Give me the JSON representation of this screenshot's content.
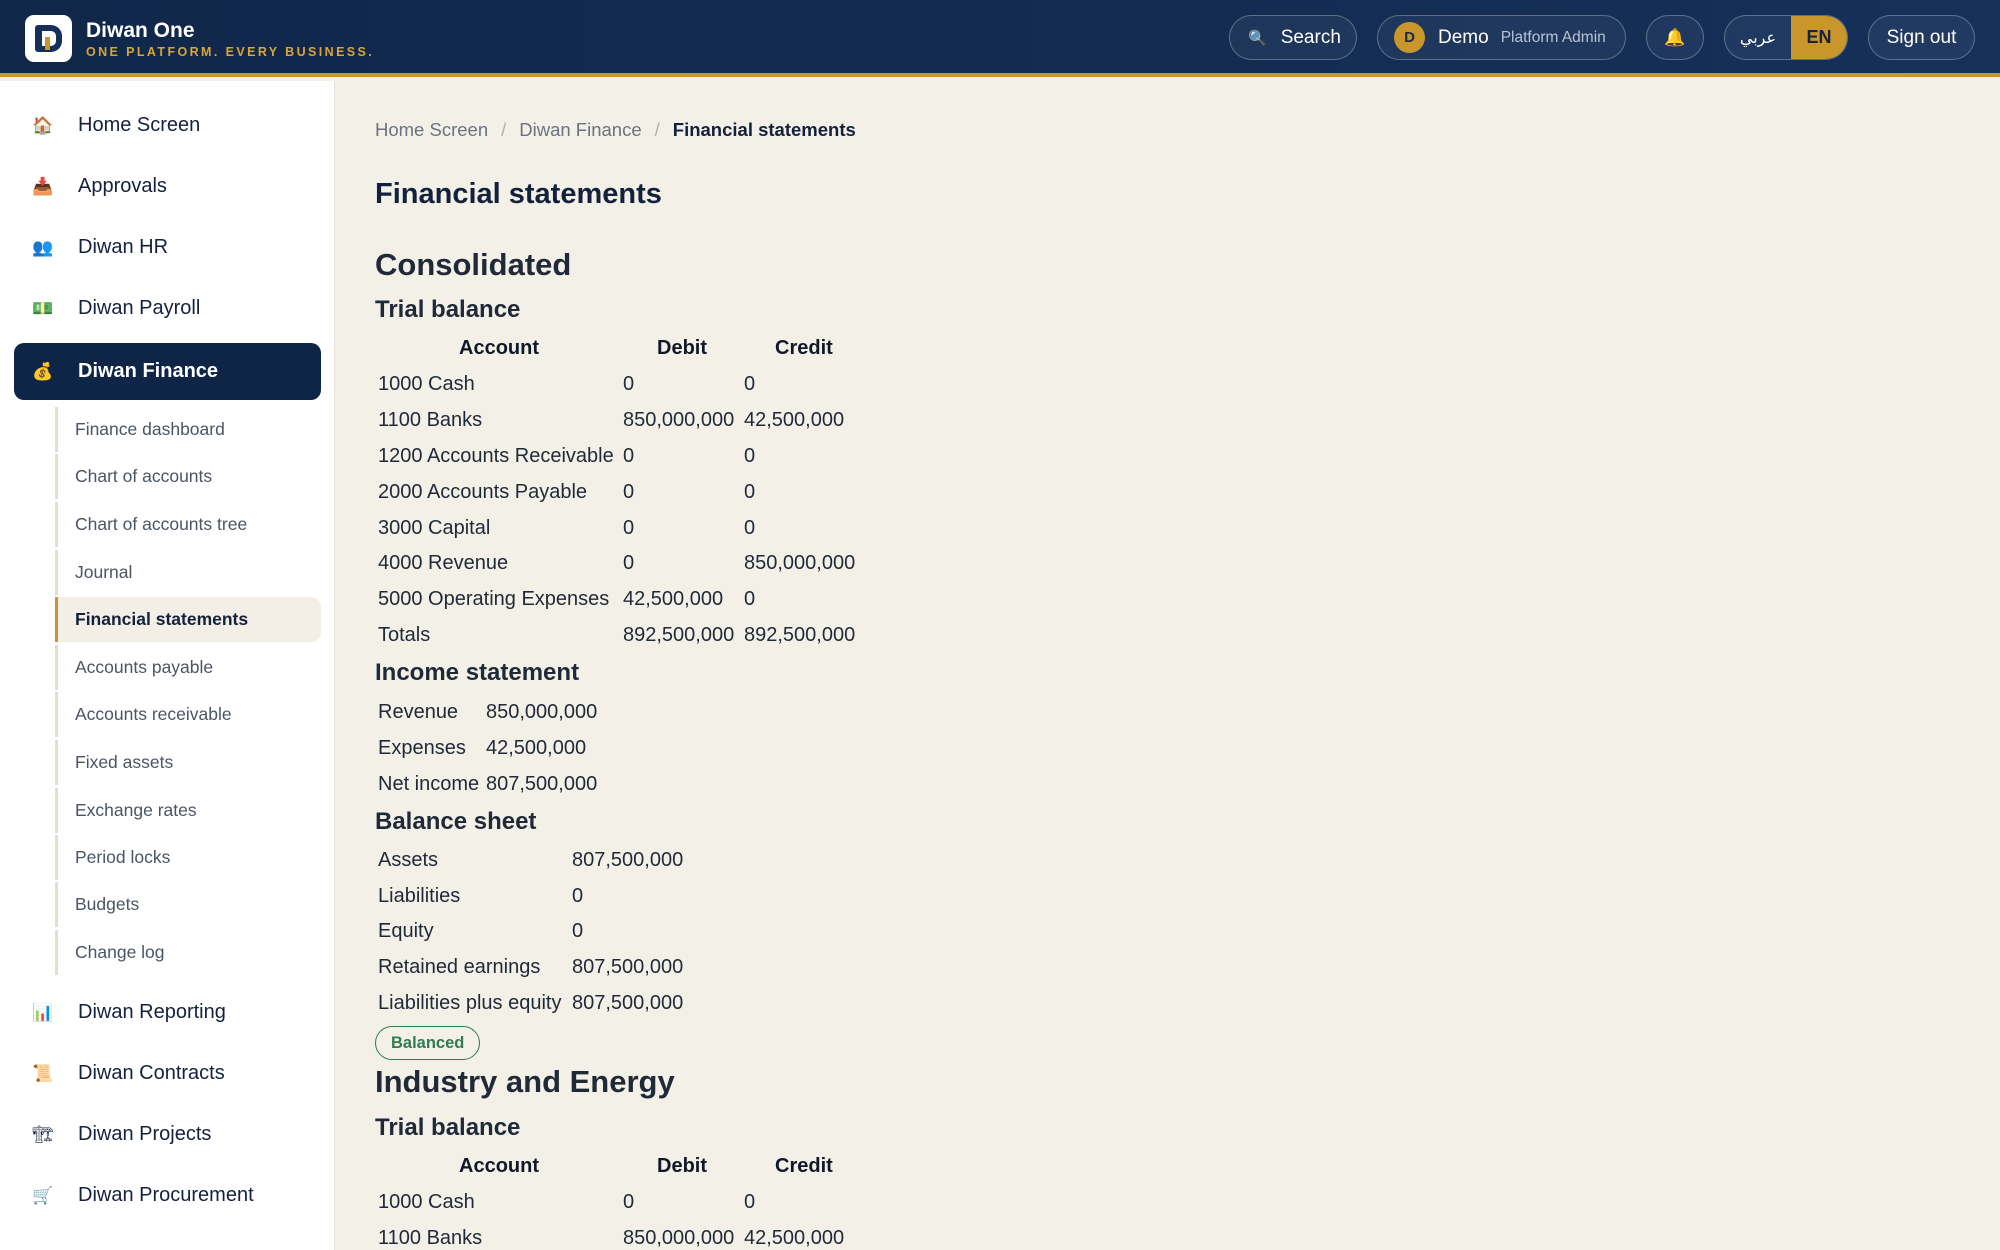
{
  "header": {
    "brand_name": "Diwan One",
    "brand_tagline": "ONE PLATFORM. EVERY BUSINESS.",
    "search_label": "Search",
    "user_initial": "D",
    "user_name": "Demo",
    "user_role": "Platform Admin",
    "lang_ar": "عربي",
    "lang_en": "EN",
    "sign_out": "Sign out"
  },
  "sidebar": {
    "items": [
      {
        "label": "Home Screen",
        "icon": "house-icon"
      },
      {
        "label": "Approvals",
        "icon": "inbox-tray-icon"
      },
      {
        "label": "Diwan HR",
        "icon": "people-icon"
      },
      {
        "label": "Diwan Payroll",
        "icon": "money-icon"
      },
      {
        "label": "Diwan Finance",
        "icon": "money-bag-icon"
      },
      {
        "label": "Diwan Reporting",
        "icon": "bar-chart-icon"
      },
      {
        "label": "Diwan Contracts",
        "icon": "scroll-icon"
      },
      {
        "label": "Diwan Projects",
        "icon": "construction-icon"
      },
      {
        "label": "Diwan Procurement",
        "icon": "cart-icon"
      }
    ],
    "finance_sub": [
      "Finance dashboard",
      "Chart of accounts",
      "Chart of accounts tree",
      "Journal",
      "Financial statements",
      "Accounts payable",
      "Accounts receivable",
      "Fixed assets",
      "Exchange rates",
      "Period locks",
      "Budgets",
      "Change log"
    ]
  },
  "breadcrumb": [
    "Home Screen",
    "Diwan Finance",
    "Financial statements"
  ],
  "page_title": "Financial statements",
  "consolidated": {
    "title": "Consolidated",
    "trial_balance": {
      "title": "Trial balance",
      "headers": [
        "Account",
        "Debit",
        "Credit"
      ],
      "rows": [
        [
          "1000 Cash",
          "0",
          "0"
        ],
        [
          "1100 Banks",
          "850,000,000",
          "42,500,000"
        ],
        [
          "1200 Accounts Receivable",
          "0",
          "0"
        ],
        [
          "2000 Accounts Payable",
          "0",
          "0"
        ],
        [
          "3000 Capital",
          "0",
          "0"
        ],
        [
          "4000 Revenue",
          "0",
          "850,000,000"
        ],
        [
          "5000 Operating Expenses",
          "42,500,000",
          "0"
        ],
        [
          "Totals",
          "892,500,000",
          "892,500,000"
        ]
      ]
    },
    "income_statement": {
      "title": "Income statement",
      "rows": [
        [
          "Revenue",
          "850,000,000"
        ],
        [
          "Expenses",
          "42,500,000"
        ],
        [
          "Net income",
          "807,500,000"
        ]
      ]
    },
    "balance_sheet": {
      "title": "Balance sheet",
      "rows": [
        [
          "Assets",
          "807,500,000"
        ],
        [
          "Liabilities",
          "0"
        ],
        [
          "Equity",
          "0"
        ],
        [
          "Retained earnings",
          "807,500,000"
        ],
        [
          "Liabilities plus equity",
          "807,500,000"
        ]
      ],
      "status": "Balanced"
    }
  },
  "industry": {
    "title": "Industry and Energy",
    "trial_balance": {
      "title": "Trial balance",
      "headers": [
        "Account",
        "Debit",
        "Credit"
      ],
      "rows": [
        [
          "1000 Cash",
          "0",
          "0"
        ],
        [
          "1100 Banks",
          "850,000,000",
          "42,500,000"
        ]
      ]
    }
  },
  "colors": {
    "navy": "#0f2547",
    "gold": "#c9962b",
    "background": "#f3f0e8",
    "balanced_green": "#2f7d4f"
  }
}
